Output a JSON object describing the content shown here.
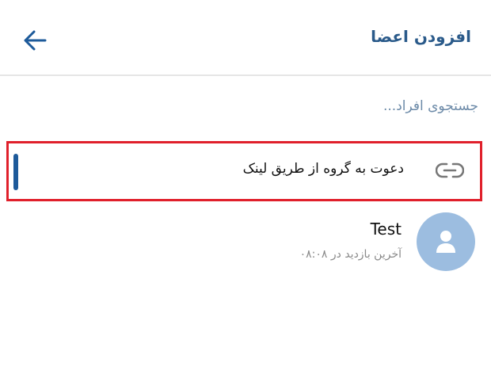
{
  "header": {
    "title": "افزودن اعضا",
    "back_icon": "arrow-left-icon"
  },
  "search": {
    "placeholder": "جستجوی افراد..."
  },
  "invite": {
    "label": "دعوت به گروه از طریق لینک",
    "icon": "link-icon"
  },
  "contacts": [
    {
      "name": "Test",
      "status": "آخرین بازدید در ۰۸:۰۸",
      "avatar_icon": "person-icon"
    }
  ],
  "colors": {
    "accent": "#2a5a8a",
    "highlight_border": "#e0202b",
    "avatar_bg": "#9cbde0",
    "placeholder": "#6c8aa8"
  }
}
